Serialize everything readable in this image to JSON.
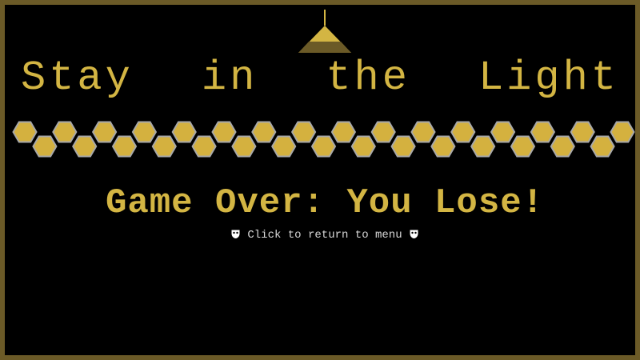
{
  "game": {
    "title_words": [
      "Stay",
      "in",
      "the",
      "Light"
    ],
    "status": "Game Over: You Lose!",
    "return_prompt": "Click to return to menu",
    "tile_count": 31
  },
  "colors": {
    "background": "#000000",
    "border": "#6b5a27",
    "accent": "#d3b543",
    "tile_fill": "#d4b13f",
    "tile_stroke": "#a8a8a8",
    "prompt_text": "#d7d7d7"
  },
  "icons": {
    "prompt_left": "mask-icon",
    "prompt_right": "mask-icon",
    "lamp": "ceiling-lamp-icon"
  }
}
